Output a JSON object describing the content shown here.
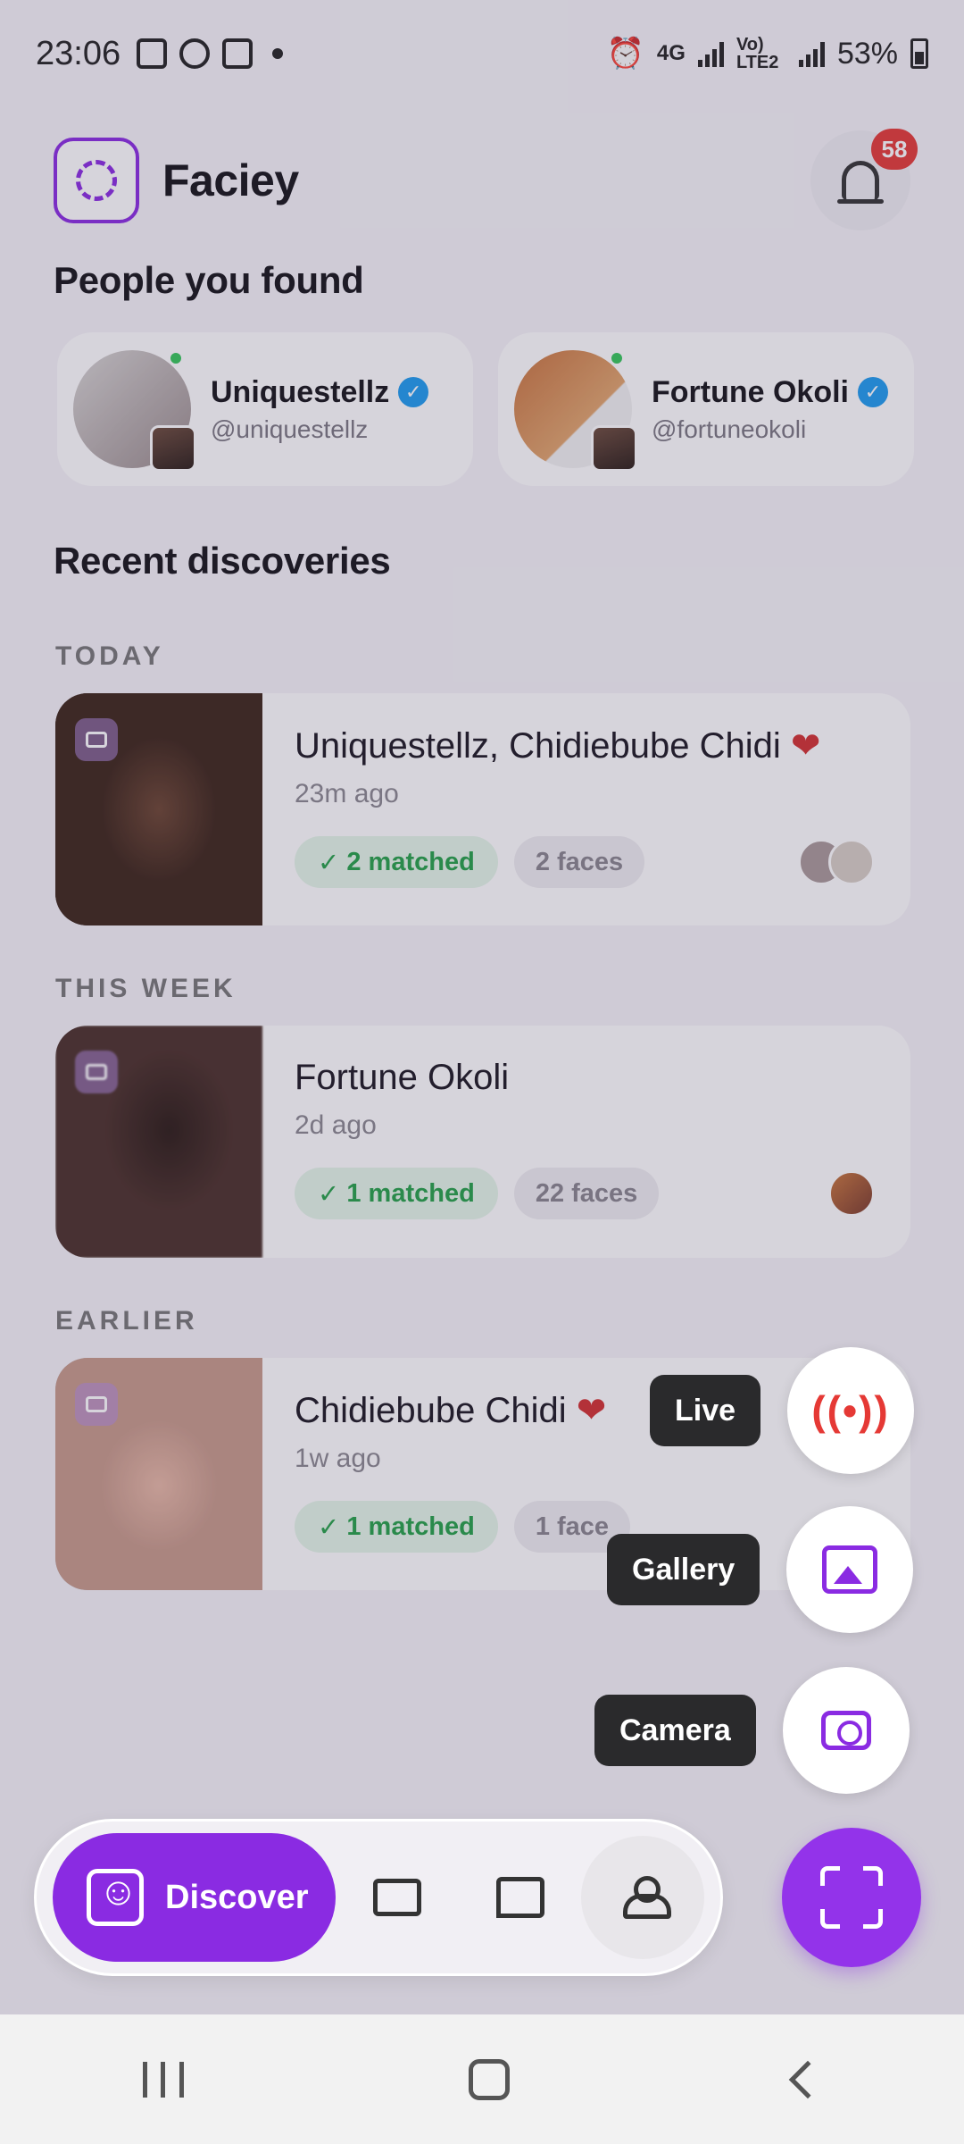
{
  "status": {
    "time": "23:06",
    "network": "4G",
    "lte": "Vo) LTE2",
    "battery": "53%"
  },
  "header": {
    "title": "Faciey",
    "notification_count": "58"
  },
  "people_found": {
    "title": "People you found",
    "items": [
      {
        "name": "Uniquestellz",
        "handle": "@uniquestellz"
      },
      {
        "name": "Fortune Okoli",
        "handle": "@fortuneokoli"
      }
    ]
  },
  "recent": {
    "title": "Recent discoveries",
    "groups": [
      {
        "label": "TODAY",
        "card": {
          "title": "Uniquestellz, Chidiebube Chidi",
          "heart": "❤",
          "time": "23m ago",
          "matched": "2 matched",
          "faces": "2 faces"
        }
      },
      {
        "label": "THIS WEEK",
        "card": {
          "title": "Fortune Okoli",
          "heart": "",
          "time": "2d ago",
          "matched": "1 matched",
          "faces": "22 faces"
        }
      },
      {
        "label": "EARLIER",
        "card": {
          "title": "Chidiebube Chidi",
          "heart": "❤",
          "time": "1w ago",
          "matched": "1 matched",
          "faces": "1 face"
        }
      }
    ]
  },
  "fab_menu": {
    "live": "Live",
    "gallery": "Gallery",
    "camera": "Camera"
  },
  "bottom_nav": {
    "discover": "Discover"
  },
  "colors": {
    "accent": "#8a2be2",
    "match_green": "#23a047",
    "live_red": "#e53935"
  }
}
